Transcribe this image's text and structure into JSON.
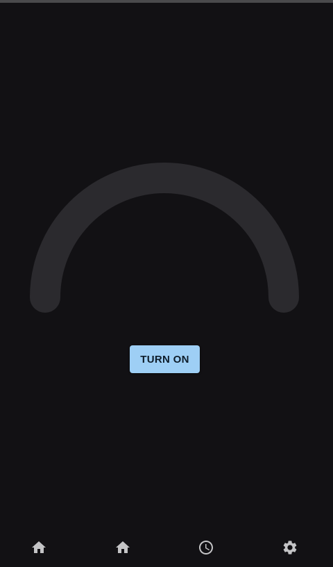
{
  "gauge": {
    "track_color": "#2b2a2e",
    "level": 0
  },
  "power_button": {
    "label": "TURN ON",
    "color": "#9ecff5"
  },
  "bottom_nav": {
    "items": [
      {
        "icon": "home-icon"
      },
      {
        "icon": "home-icon"
      },
      {
        "icon": "clock-icon"
      },
      {
        "icon": "gear-icon"
      }
    ]
  },
  "colors": {
    "background": "#121114",
    "icon": "#c4c4c6"
  }
}
